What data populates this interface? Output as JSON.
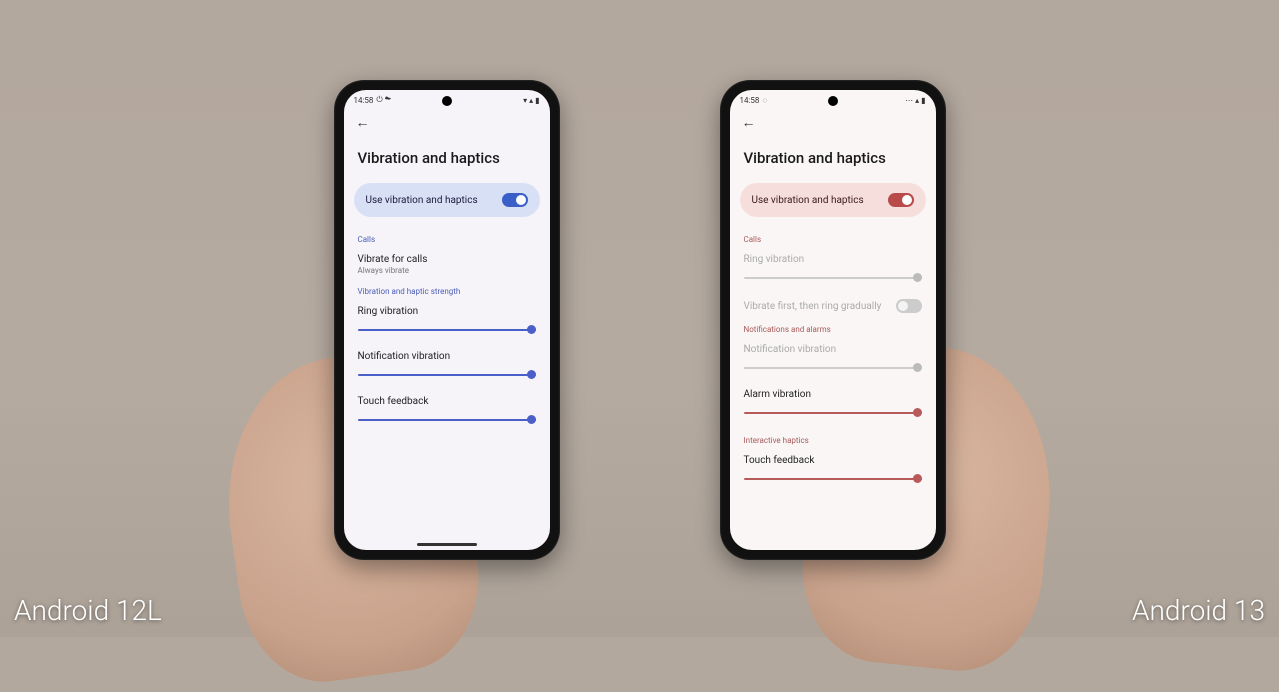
{
  "captions": {
    "left": "Android 12L",
    "right": "Android 13"
  },
  "left_phone": {
    "status": {
      "time": "14:58",
      "icons_left": "⏻ ☁",
      "icons_right": "▾ ▴ ▮"
    },
    "page_title": "Vibration and haptics",
    "master": {
      "label": "Use vibration and haptics",
      "on": true
    },
    "section_calls": "Calls",
    "vibrate_for_calls": {
      "title": "Vibrate for calls",
      "sub": "Always vibrate"
    },
    "section_strength": "Vibration and haptic strength",
    "sliders": {
      "ring": "Ring vibration",
      "notification": "Notification vibration",
      "touch": "Touch feedback"
    }
  },
  "right_phone": {
    "status": {
      "time": "14:58",
      "icons_left": "◌",
      "icons_right": "⋯ ▴ ▮"
    },
    "page_title": "Vibration and haptics",
    "master": {
      "label": "Use vibration and haptics",
      "on": true
    },
    "section_calls": "Calls",
    "ring_vibration": "Ring vibration",
    "vibrate_first": {
      "label": "Vibrate first, then ring gradually",
      "on": false
    },
    "section_notif": "Notifications and alarms",
    "notification_vibration": "Notification vibration",
    "alarm_vibration": "Alarm vibration",
    "section_haptics": "Interactive haptics",
    "touch_feedback": "Touch feedback"
  }
}
